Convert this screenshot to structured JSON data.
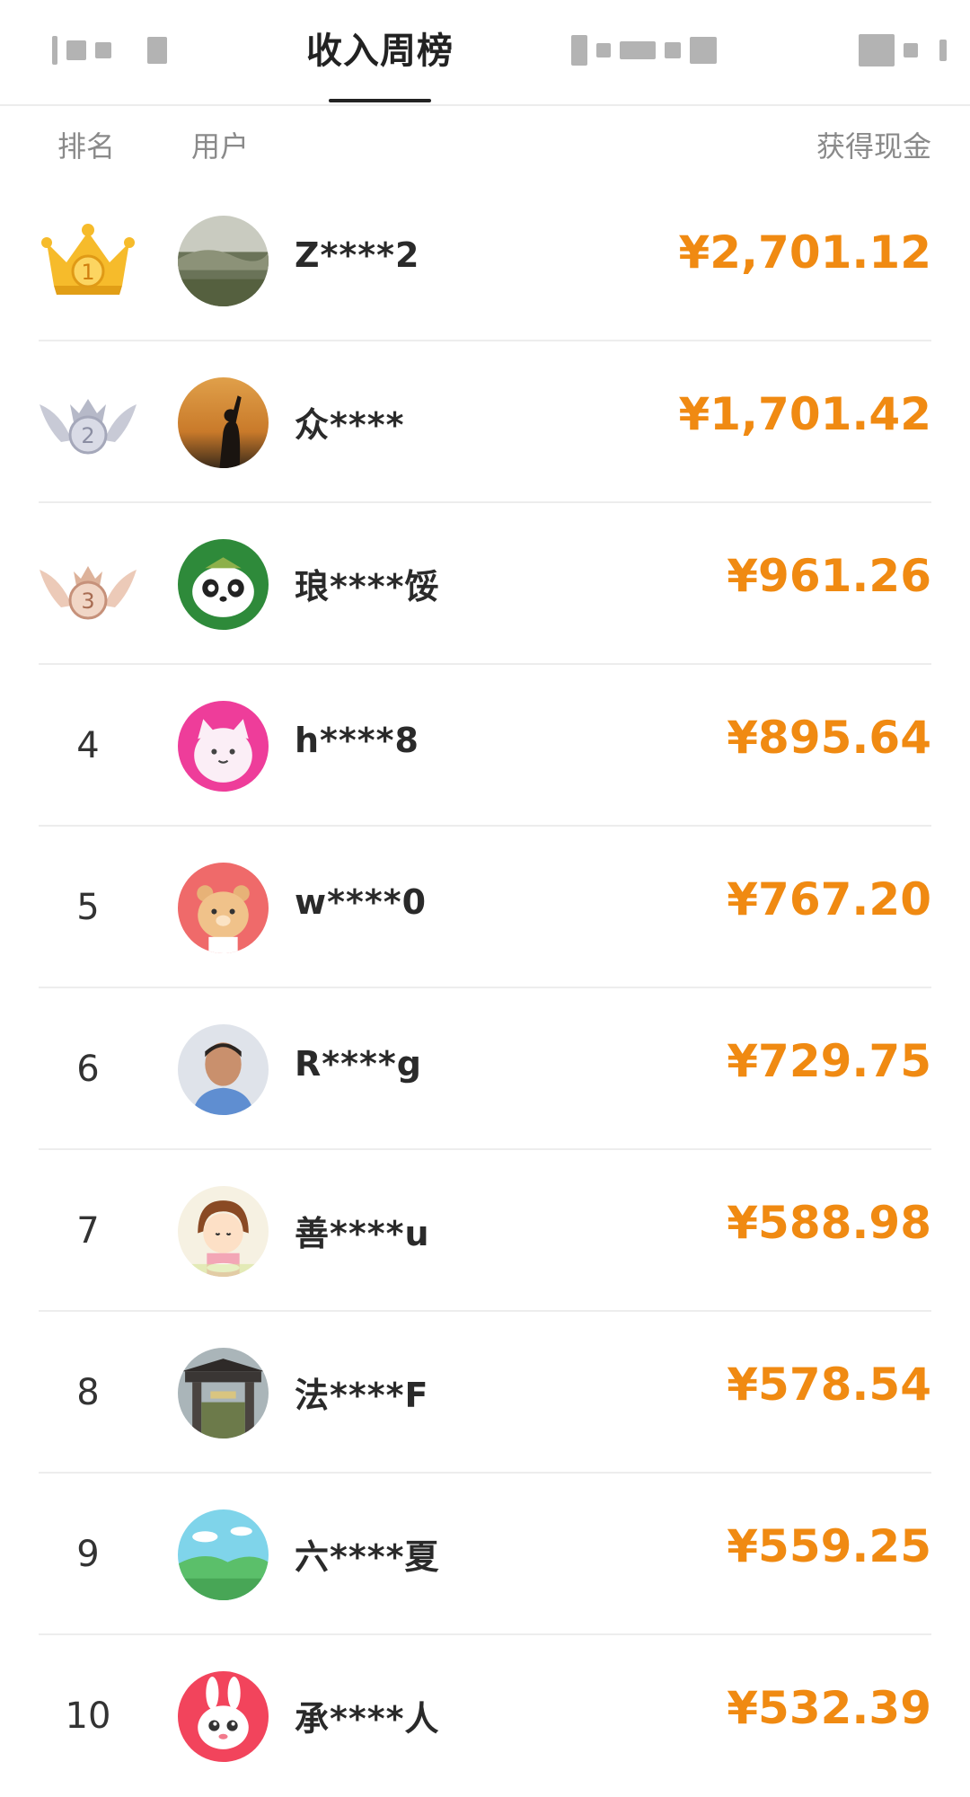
{
  "tabs": {
    "active_label": "收入周榜"
  },
  "columns": {
    "rank": "排名",
    "user": "用户",
    "cash": "获得现金"
  },
  "rows": [
    {
      "rank": "1",
      "name": "Z****2",
      "amount": "¥2,701.12",
      "medal": "gold"
    },
    {
      "rank": "2",
      "name": "众****",
      "amount": "¥1,701.42",
      "medal": "silver"
    },
    {
      "rank": "3",
      "name": "琅****馁",
      "amount": "¥961.26",
      "medal": "bronze"
    },
    {
      "rank": "4",
      "name": "h****8",
      "amount": "¥895.64"
    },
    {
      "rank": "5",
      "name": "w****0",
      "amount": "¥767.20"
    },
    {
      "rank": "6",
      "name": "R****g",
      "amount": "¥729.75"
    },
    {
      "rank": "7",
      "name": "善****u",
      "amount": "¥588.98"
    },
    {
      "rank": "8",
      "name": "法****F",
      "amount": "¥578.54"
    },
    {
      "rank": "9",
      "name": "六****夏",
      "amount": "¥559.25"
    },
    {
      "rank": "10",
      "name": "承****人",
      "amount": "¥532.39"
    }
  ],
  "colors": {
    "amount": "#f08a12",
    "gold": "#f3b325",
    "silver": "#b9bccb",
    "bronze": "#e2b7a0"
  }
}
